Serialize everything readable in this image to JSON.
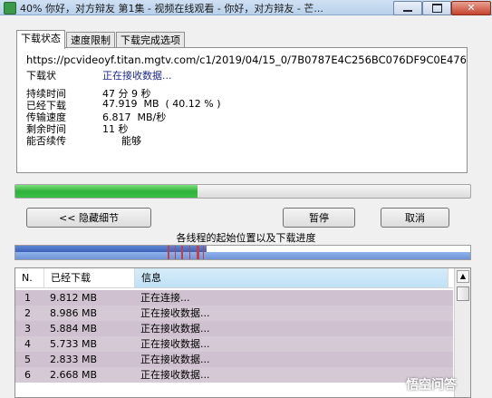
{
  "window": {
    "title": "40% 你好，对方辩友 第1集 - 视频在线观看 - 你好，对方辩友 - 芒..."
  },
  "tabs": [
    {
      "label": "下载状态"
    },
    {
      "label": "速度限制"
    },
    {
      "label": "下载完成选项"
    }
  ],
  "status": {
    "url": "https://pcvideoyf.titan.mgtv.com/c1/2019/04/15_0/7B0787E4C256BC076DF9C0E476",
    "status_label": "下载状",
    "status_value": "正在接收数据...",
    "rows": [
      {
        "label": "持续时间",
        "value": "47 分 9 秒"
      },
      {
        "label": "已经下载",
        "value": "47.919  MB  ( 40.12 % )"
      },
      {
        "label": "传输速度",
        "value": "6.817  MB/秒"
      },
      {
        "label": "剩余时间",
        "value": "11 秒"
      },
      {
        "label": "能否续传",
        "value": "      能够"
      }
    ]
  },
  "progress": {
    "fraction": 0.4012
  },
  "buttons": {
    "hide_details": "<< 隐藏细节",
    "pause": "暂停",
    "cancel": "取消"
  },
  "segments": {
    "caption": "各线程的起始位置以及下载进度"
  },
  "thread_list": {
    "columns": [
      "N.",
      "已经下载",
      "信息"
    ],
    "rows": [
      {
        "n": "1",
        "downloaded": "9.812 MB",
        "info": "正在连接..."
      },
      {
        "n": "2",
        "downloaded": "8.986 MB",
        "info": "正在接收数据..."
      },
      {
        "n": "3",
        "downloaded": "5.884 MB",
        "info": "正在接收数据..."
      },
      {
        "n": "4",
        "downloaded": "5.733 MB",
        "info": "正在接收数据..."
      },
      {
        "n": "5",
        "downloaded": "2.833 MB",
        "info": "正在接收数据..."
      },
      {
        "n": "6",
        "downloaded": "2.668 MB",
        "info": "正在接收数据..."
      }
    ]
  },
  "watermark": "悟空问答"
}
